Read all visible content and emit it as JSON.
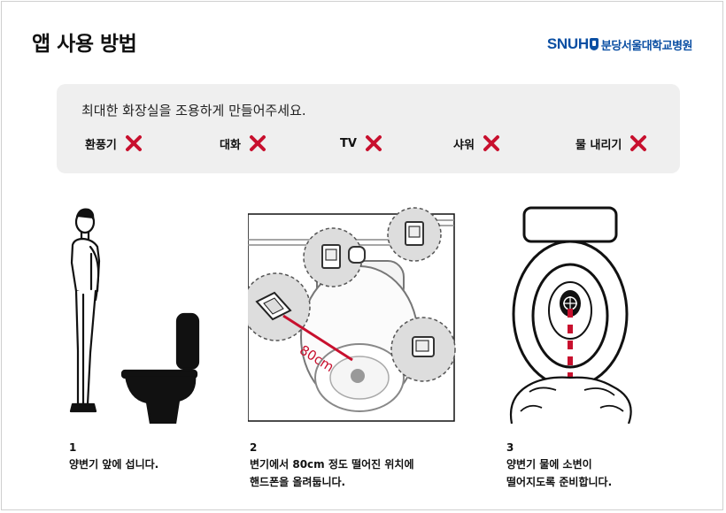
{
  "page": {
    "title": "앱 사용 방법",
    "logo": {
      "mark": "SNUH",
      "name": "분당서울대학교병원"
    }
  },
  "notice": {
    "message": "최대한 화장실을 조용하게 만들어주세요.",
    "items": [
      "환풍기",
      "대화",
      "TV",
      "샤워",
      "물 내리기"
    ],
    "status_icon": "x-mark-icon",
    "accent_color": "#c8102e"
  },
  "steps": [
    {
      "number": "1",
      "lines": [
        "양변기 앞에 섭니다."
      ]
    },
    {
      "number": "2",
      "lines": [
        "변기에서 80cm 정도 떨어진 위치에",
        "핸드폰을 올려둡니다."
      ],
      "distance_label": "80cm"
    },
    {
      "number": "3",
      "lines": [
        "양변기 물에 소변이",
        "떨어지도록 준비합니다."
      ]
    }
  ]
}
